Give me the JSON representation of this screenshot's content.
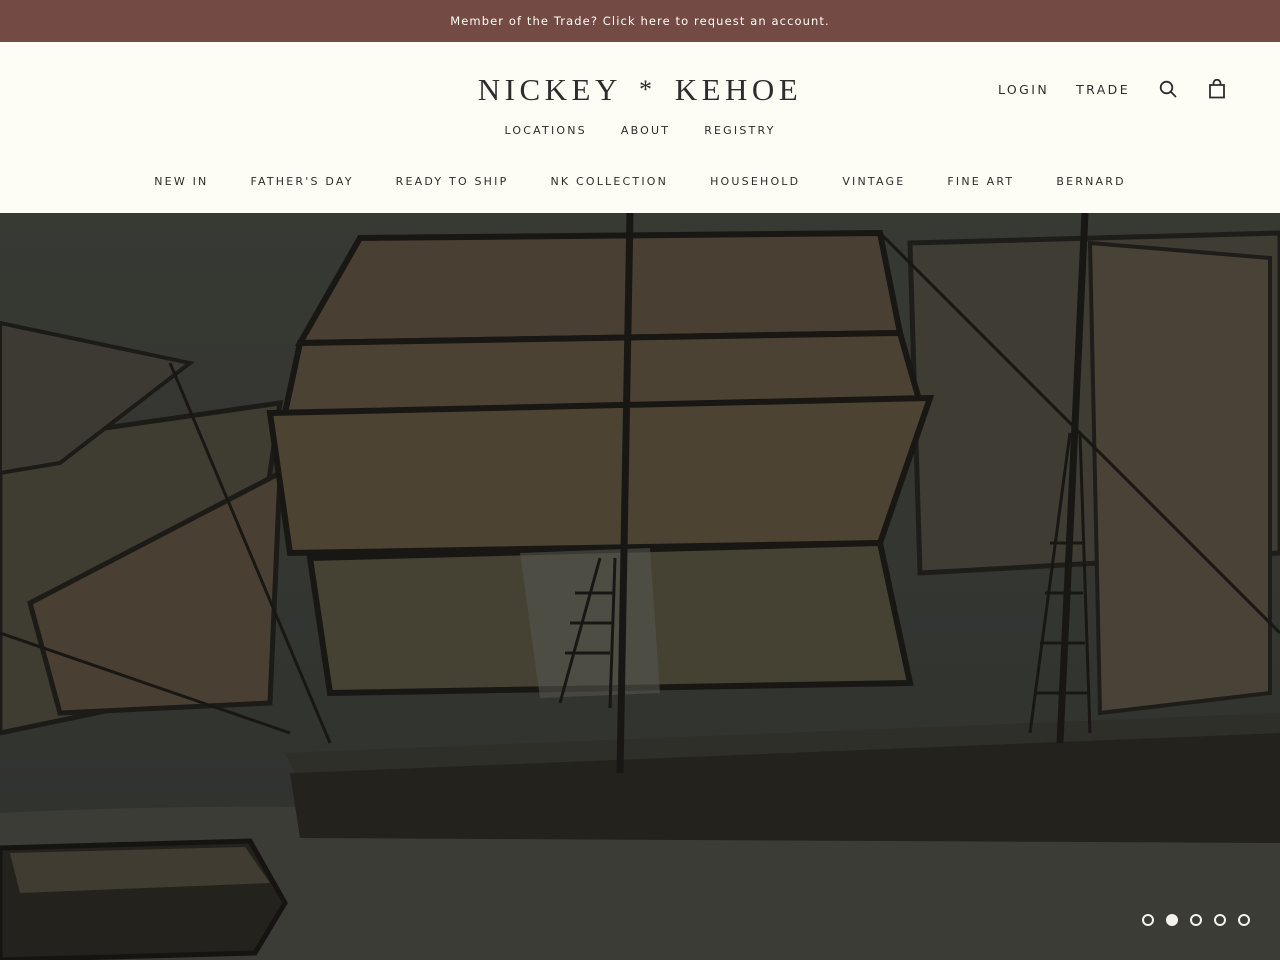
{
  "announcement": {
    "text": "Member of the Trade? Click here to request an account."
  },
  "header": {
    "logo": {
      "left": "NICKEY",
      "mark": "*",
      "right": "KEHOE"
    },
    "subnav": [
      "LOCATIONS",
      "ABOUT",
      "REGISTRY"
    ],
    "account": {
      "login": "LOGIN",
      "trade": "TRADE",
      "search_icon": "search-icon",
      "cart_icon": "shopping-bag-icon"
    },
    "mainnav": [
      "NEW IN",
      "FATHER'S DAY",
      "READY TO SHIP",
      "NK COLLECTION",
      "HOUSEHOLD",
      "VINTAGE",
      "FINE ART",
      "BERNARD"
    ]
  },
  "hero": {
    "image": "folk-art painting of a sailing ship",
    "slides": {
      "count": 5,
      "active": 2
    }
  },
  "colors": {
    "announcement_bg": "#734a44",
    "page_bg": "#fdfdf5",
    "text": "#2d2d2d"
  }
}
